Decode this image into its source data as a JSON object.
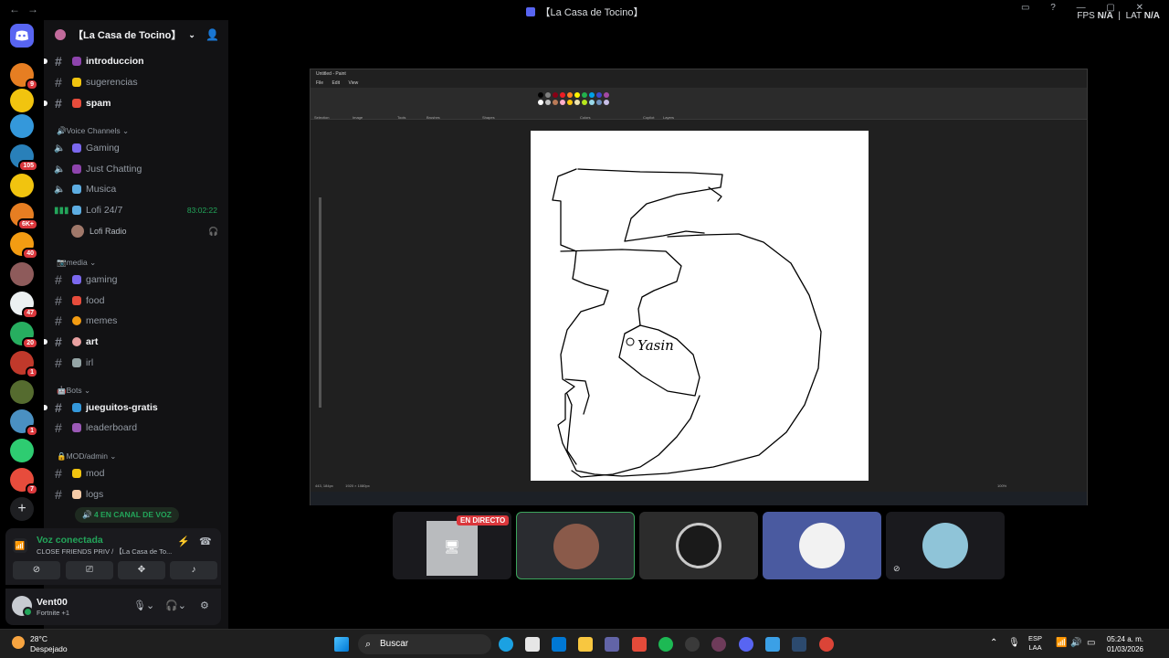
{
  "window": {
    "title": "【La Casa de Tocino】",
    "fps_label": "FPS",
    "fps_value": "N/A",
    "lat_label": "LAT",
    "lat_value": "N/A"
  },
  "servers": [
    {
      "color": "#e67e22",
      "badge": "9"
    },
    {
      "color": "#f1c40f",
      "badge": ""
    },
    {
      "color": "#3498db",
      "badge": ""
    },
    {
      "color": "#2980b9",
      "badge": "105"
    },
    {
      "color": "#f1c40f",
      "badge": ""
    },
    {
      "color": "#e67e22",
      "badge": "6K+"
    },
    {
      "color": "#f39c12",
      "badge": "40"
    },
    {
      "color": "#8e5b5b",
      "badge": ""
    },
    {
      "color": "#ecf0f1",
      "badge": "47"
    },
    {
      "color": "#27ae60",
      "badge": "20"
    },
    {
      "color": "#c0392b",
      "badge": "1"
    },
    {
      "color": "#556b2f",
      "badge": ""
    },
    {
      "color": "#4a90c2",
      "badge": "1"
    },
    {
      "color": "#2ecc71",
      "badge": ""
    },
    {
      "color": "#e74c3c",
      "badge": "7"
    }
  ],
  "guild": {
    "name": "【La Casa de Tocino】"
  },
  "channels": {
    "introduccion": "introduccion",
    "sugerencias": "sugerencias",
    "spam": "spam",
    "cat_voice": "🔊Voice Channels",
    "gaming_voice": "Gaming",
    "just_chatting": "Just Chatting",
    "musica": "Musica",
    "lofi": "Lofi 24/7",
    "lofi_timer": "83:02:22",
    "lofi_user": "Lofi Radio",
    "cat_media": "📷media",
    "gaming": "gaming",
    "food": "food",
    "memes": "memes",
    "art": "art",
    "irl": "irl",
    "cat_bots": "🤖Bots",
    "jueguitos": "jueguitos-gratis",
    "leaderboard": "leaderboard",
    "cat_mod": "🔒MOD/admin",
    "mod": "mod",
    "logs": "logs",
    "voice_count": "4 EN CANAL DE VOZ"
  },
  "voice": {
    "status": "Voz conectada",
    "sub": "CLOSE FRIENDS PRIV / 【La Casa de To..."
  },
  "user": {
    "name": "Vent00",
    "status": "Fortnite +1"
  },
  "paint": {
    "title": "Untitled - Paint",
    "menu": [
      "File",
      "Edit",
      "View"
    ],
    "groups": [
      "Selection",
      "Image",
      "Tools",
      "Brushes",
      "Shapes",
      "Colors",
      "Copilot",
      "Layers"
    ],
    "status_left": "443, 184px",
    "status_size": "1920 × 1080px",
    "zoom": "100%",
    "canvas_text": "Yasin"
  },
  "tiles": {
    "live_label": "EN DIRECTO"
  },
  "taskbar": {
    "temp": "28°C",
    "condition": "Despejado",
    "search_placeholder": "Buscar",
    "lang_top": "ESP",
    "lang_bottom": "LAA",
    "time": "05:24 a. m.",
    "date": "01/03/2026"
  }
}
